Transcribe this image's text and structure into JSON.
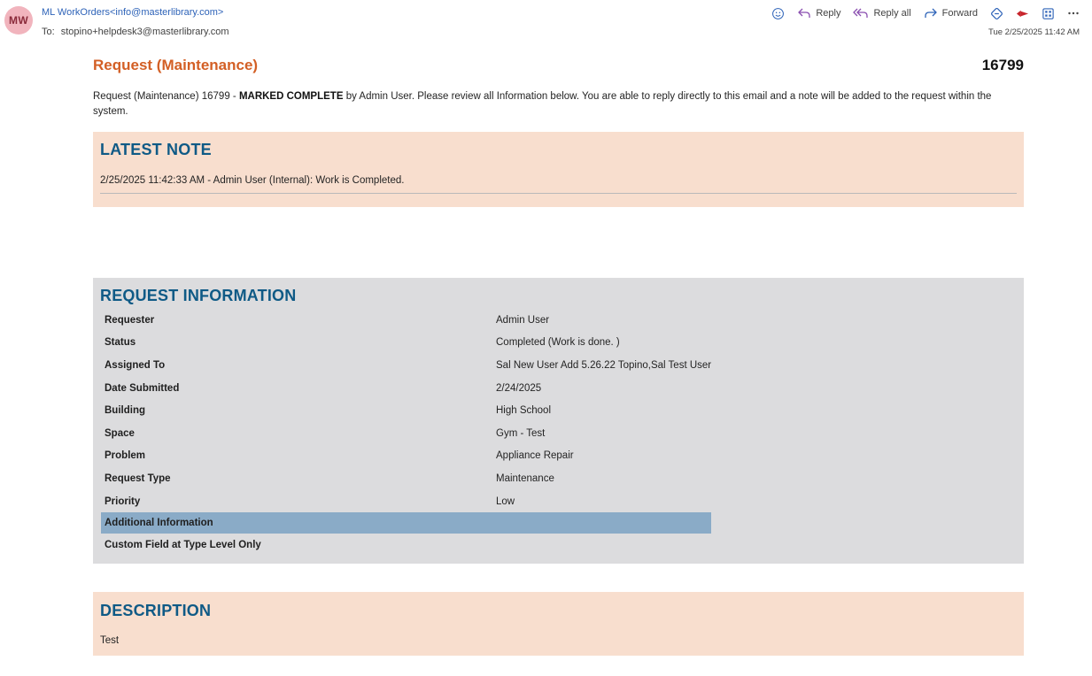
{
  "email": {
    "avatar_initials": "MW",
    "from": "ML WorkOrders<info@masterlibrary.com>",
    "to_label": "To:",
    "to": "stopino+helpdesk3@masterlibrary.com",
    "timestamp": "Tue 2/25/2025 11:42 AM",
    "actions": {
      "reply": "Reply",
      "reply_all": "Reply all",
      "forward": "Forward"
    },
    "icons": [
      "emoji-icon",
      "reply-icon",
      "reply-all-icon",
      "forward-icon",
      "loop-icon",
      "dynamics-icon",
      "apps-icon",
      "more-icon"
    ],
    "colors": {
      "accent": "#2e63b8",
      "avatar_bg": "#f1b4bd"
    }
  },
  "request": {
    "title": "Request (Maintenance)",
    "number": "16799",
    "intro_prefix": "Request (Maintenance) 16799 - ",
    "intro_bold": "MARKED COMPLETE",
    "intro_suffix": " by Admin User. Please review all Information below. You are able to reply directly to this email and a note will be added to the request within the system."
  },
  "latest_note": {
    "heading": "LATEST NOTE",
    "text": "2/25/2025 11:42:33 AM - Admin User (Internal): Work is Completed."
  },
  "request_information": {
    "heading": "REQUEST INFORMATION",
    "rows": [
      {
        "label": "Requester",
        "value": "Admin User"
      },
      {
        "label": "Status",
        "value": "Completed (Work is done. )"
      },
      {
        "label": "Assigned To",
        "value": "Sal New User Add 5.26.22 Topino,Sal Test User"
      },
      {
        "label": "Date Submitted",
        "value": "2/24/2025"
      },
      {
        "label": "Building",
        "value": "High School"
      },
      {
        "label": "Space",
        "value": "Gym - Test"
      },
      {
        "label": "Problem",
        "value": "Appliance Repair"
      },
      {
        "label": "Request Type",
        "value": "Maintenance"
      },
      {
        "label": "Priority",
        "value": "Low"
      }
    ],
    "additional_heading": "Additional Information",
    "custom_field_label": "Custom Field at Type Level Only",
    "custom_field_value": ""
  },
  "description": {
    "heading": "DESCRIPTION",
    "text": "Test"
  },
  "colors": {
    "title_orange": "#d35f25",
    "heading_blue": "#0f5a86",
    "peach_panel": "#f8dece",
    "grey_panel": "#dcdcde",
    "highlight_row": "#8aabc7"
  }
}
